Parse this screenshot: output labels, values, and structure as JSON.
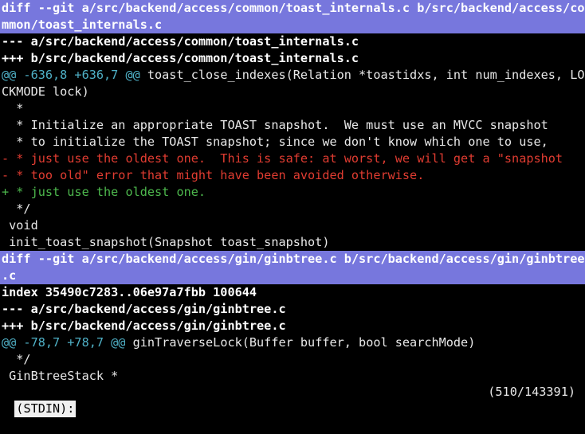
{
  "colors": {
    "background": "#000000",
    "header_highlight": "#7777dd",
    "hunk": "#4fb0c6",
    "deleted": "#e03c31",
    "added": "#4db84d",
    "text": "#e8e8e8"
  },
  "diff": {
    "file1": {
      "header_line1": "diff --git a/src/backend/access/common/toast_internals.c b/src/backend/access/co",
      "header_line2": "mmon/toast_internals.c",
      "old_file": "--- a/src/backend/access/common/toast_internals.c",
      "new_file": "+++ b/src/backend/access/common/toast_internals.c",
      "hunk_range": "@@ -636,8 +636,7 @@",
      "hunk_context": " toast_close_indexes(Relation *toastidxs, int num_indexes, LO",
      "hunk_context_wrap": "CKMODE lock)",
      "lines": [
        {
          "type": "ctx",
          "text": "  *"
        },
        {
          "type": "ctx",
          "text": "  * Initialize an appropriate TOAST snapshot.  We must use an MVCC snapshot"
        },
        {
          "type": "ctx",
          "text": "  * to initialize the TOAST snapshot; since we don't know which one to use,"
        },
        {
          "type": "del",
          "text": "- * just use the oldest one.  This is safe: at worst, we will get a \"snapshot"
        },
        {
          "type": "del",
          "text": "- * too old\" error that might have been avoided otherwise."
        },
        {
          "type": "add",
          "text": "+ * just use the oldest one."
        },
        {
          "type": "ctx",
          "text": "  */"
        },
        {
          "type": "ctx",
          "text": " void"
        },
        {
          "type": "ctx",
          "text": " init_toast_snapshot(Snapshot toast_snapshot)"
        }
      ]
    },
    "file2": {
      "header_line1": "diff --git a/src/backend/access/gin/ginbtree.c b/src/backend/access/gin/ginbtree",
      "header_line2": ".c",
      "index": "index 35490c7283..06e97a7fbb 100644",
      "old_file": "--- a/src/backend/access/gin/ginbtree.c",
      "new_file": "+++ b/src/backend/access/gin/ginbtree.c",
      "hunk_range": "@@ -78,7 +78,7 @@",
      "hunk_context": " ginTraverseLock(Buffer buffer, bool searchMode)",
      "lines": [
        {
          "type": "ctx",
          "text": "  */"
        },
        {
          "type": "ctx",
          "text": " GinBtreeStack *"
        }
      ]
    }
  },
  "status": {
    "label": "(STDIN):",
    "position": "(510/143391)"
  }
}
